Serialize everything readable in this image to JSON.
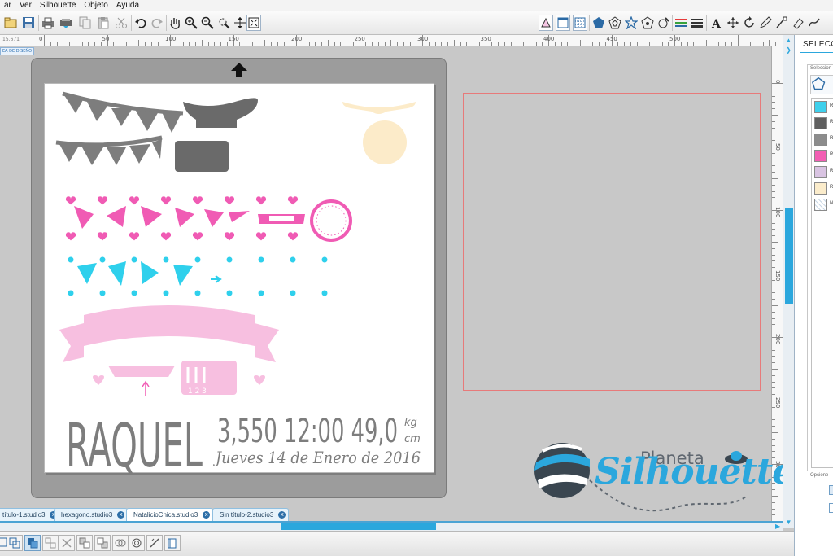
{
  "menu": [
    "ar",
    "Ver",
    "Silhouette",
    "Objeto",
    "Ayuda"
  ],
  "ruler": {
    "coordinate_readout": "15.671",
    "h_labels": [
      "0",
      "50",
      "100",
      "150",
      "200",
      "250",
      "300",
      "350",
      "400",
      "450",
      "500"
    ],
    "v_labels": [
      "0",
      "50",
      "100",
      "150",
      "200",
      "250",
      "300"
    ]
  },
  "design_label": "EA DE DISEÑO",
  "page_content": {
    "name": "RAQUEL",
    "stats": "3,550 12:00 49,0",
    "unit_top": "kg",
    "unit_bottom": "cm",
    "date_line": "Jueves 14 de Enero de 2016",
    "ruler_digits": "1 2 3"
  },
  "watermark": {
    "line1": "Planeta",
    "line2": "Silhouette"
  },
  "tabs": [
    {
      "label": "título-1.studio3",
      "active": false
    },
    {
      "label": "hexagono.studio3",
      "active": false
    },
    {
      "label": "NatalicioChica.studio3",
      "active": true
    },
    {
      "label": "Sin título-2.studio3",
      "active": false
    }
  ],
  "right_panel": {
    "title": "SELECCIÓN",
    "section_caption": "Seleccion",
    "options_caption": "Opcione",
    "swatches": [
      {
        "color": "#3fd0ec",
        "label": "R"
      },
      {
        "color": "#5f5f5f",
        "label": "R"
      },
      {
        "color": "#8c8c8c",
        "label": "R"
      },
      {
        "color": "#f25fb3",
        "label": "R"
      },
      {
        "color": "#d9c4e2",
        "label": "R"
      },
      {
        "color": "#fbeccb",
        "label": "R"
      },
      {
        "color": "#ffffff",
        "label": "N"
      }
    ]
  },
  "colors": {
    "accent": "#2ba7dd",
    "pink": "#f05bb4",
    "light_pink": "#f7bfe0",
    "cyan": "#2fd0ec",
    "gray": "#7d7d7d",
    "cream": "#fcebc9"
  }
}
